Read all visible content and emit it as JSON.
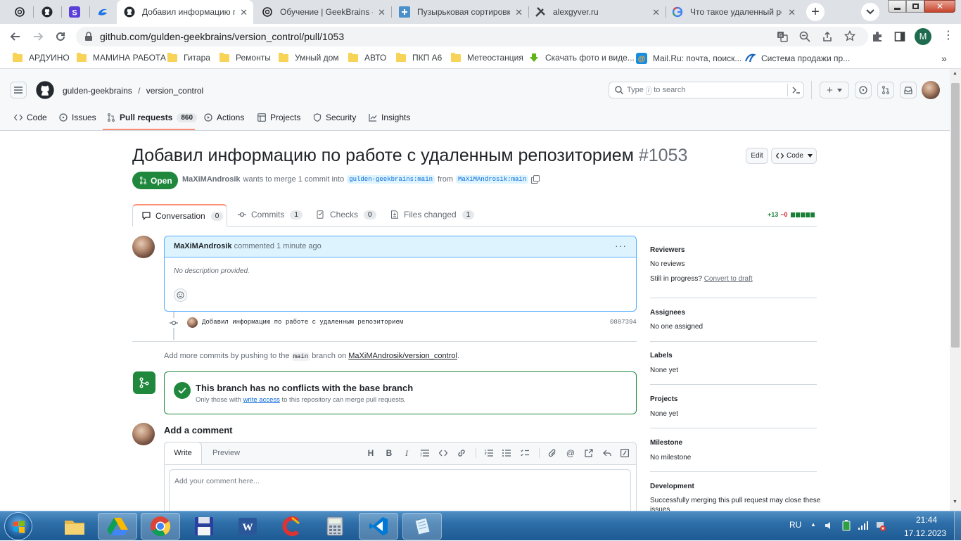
{
  "browser": {
    "tabs": [
      {
        "title": "",
        "icon": "openai-icon"
      },
      {
        "title": "",
        "icon": "github-icon"
      },
      {
        "title": "",
        "icon": "s-app-icon"
      },
      {
        "title": "",
        "icon": "edge-swirl-icon"
      },
      {
        "title": "Добавил информацию по",
        "icon": "github-icon",
        "active": true
      },
      {
        "title": "Обучение | GeekBrains - о",
        "icon": "openai-icon"
      },
      {
        "title": "Пузырьковая сортировка",
        "icon": "puzzle-icon"
      },
      {
        "title": "alexgyver.ru",
        "icon": "tools-icon"
      },
      {
        "title": "Что такое удаленный репо",
        "icon": "google-icon"
      }
    ],
    "url": "github.com/gulden-geekbrains/version_control/pull/1053",
    "profile_letter": "M",
    "bookmarks": [
      {
        "label": "АРДУИНО",
        "icon": "folder-icon"
      },
      {
        "label": "МАМИНА РАБОТА",
        "icon": "folder-icon"
      },
      {
        "label": "Гитара",
        "icon": "folder-icon"
      },
      {
        "label": "Ремонты",
        "icon": "folder-icon"
      },
      {
        "label": "Умный дом",
        "icon": "folder-icon"
      },
      {
        "label": "АВТО",
        "icon": "folder-icon"
      },
      {
        "label": "ПКП А6",
        "icon": "folder-icon"
      },
      {
        "label": "Метеостанция",
        "icon": "folder-icon"
      },
      {
        "label": "Скачать фото и виде...",
        "icon": "download-arrow-icon"
      },
      {
        "label": "Mail.Ru: почта, поиск...",
        "icon": "mailru-icon"
      },
      {
        "label": "Система продажи пр...",
        "icon": "system-icon"
      }
    ]
  },
  "github": {
    "owner": "gulden-geekbrains",
    "separator": "/",
    "repo": "version_control",
    "search_placeholder_pre": "Type",
    "search_key": "/",
    "search_placeholder_post": "to search",
    "nav": [
      {
        "label": "Code",
        "icon": "code-icon"
      },
      {
        "label": "Issues",
        "icon": "issue-icon"
      },
      {
        "label": "Pull requests",
        "icon": "pull-request-icon",
        "count": "860",
        "selected": true
      },
      {
        "label": "Actions",
        "icon": "play-icon"
      },
      {
        "label": "Projects",
        "icon": "table-icon"
      },
      {
        "label": "Security",
        "icon": "shield-icon"
      },
      {
        "label": "Insights",
        "icon": "graph-icon"
      }
    ]
  },
  "pr": {
    "title": "Добавил информацию по работе с удаленным репозиторием",
    "number": "#1053",
    "edit_label": "Edit",
    "code_label": "Code",
    "state": "Open",
    "author": "MaXiMAndrosik",
    "merge_text": "wants to merge 1 commit into",
    "base_branch": "gulden-geekbrains:main",
    "from_text": "from",
    "head_branch": "MaXiMAndrosik:main",
    "tabs": [
      {
        "label": "Conversation",
        "count": "0",
        "icon": "comment-icon"
      },
      {
        "label": "Commits",
        "count": "1",
        "icon": "commit-icon"
      },
      {
        "label": "Checks",
        "count": "0",
        "icon": "checklist-icon"
      },
      {
        "label": "Files changed",
        "count": "1",
        "icon": "file-diff-icon"
      }
    ],
    "additions": "+13",
    "deletions": "−0",
    "diff_colors": {
      "add": "#1a7f37",
      "neutral": "#d0d7de"
    }
  },
  "comment": {
    "author": "MaXiMAndrosik",
    "action": "commented",
    "time": "1 minute ago",
    "body": "No description provided."
  },
  "commit": {
    "message": "Добавил информацию по работе с удаленным репозиторием",
    "sha": "0887394"
  },
  "push_hint": {
    "pre": "Add more commits by pushing to the",
    "branch": "main",
    "mid": "branch on",
    "repo": "MaXiMAndrosik/version_control",
    "post": "."
  },
  "merge_box": {
    "title": "This branch has no conflicts with the base branch",
    "sub_pre": "Only those with",
    "sub_link": "write access",
    "sub_post": "to this repository can merge pull requests."
  },
  "new_comment": {
    "heading": "Add a comment",
    "write_tab": "Write",
    "preview_tab": "Preview",
    "placeholder": "Add your comment here..."
  },
  "sidebar": {
    "reviewers_h": "Reviewers",
    "reviewers_v": "No reviews",
    "progress_pre": "Still in progress?",
    "progress_link": "Convert to draft",
    "assignees_h": "Assignees",
    "assignees_v": "No one assigned",
    "labels_h": "Labels",
    "labels_v": "None yet",
    "projects_h": "Projects",
    "projects_v": "None yet",
    "milestone_h": "Milestone",
    "milestone_v": "No milestone",
    "development_h": "Development",
    "development_v": "Successfully merging this pull request may close these",
    "development_v2": "issues."
  },
  "taskbar": {
    "lang": "RU",
    "time": "21:44",
    "date": "17.12.2023",
    "apps": [
      "explorer-icon",
      "google-drive-icon",
      "chrome-icon",
      "floppy-icon",
      "word-icon",
      "ccleaner-icon",
      "calculator-icon",
      "vscode-icon",
      "notepad-icon"
    ]
  },
  "colors": {
    "open_green": "#1f883d",
    "link_blue": "#0969da",
    "accent_orange": "#fd8c73"
  }
}
